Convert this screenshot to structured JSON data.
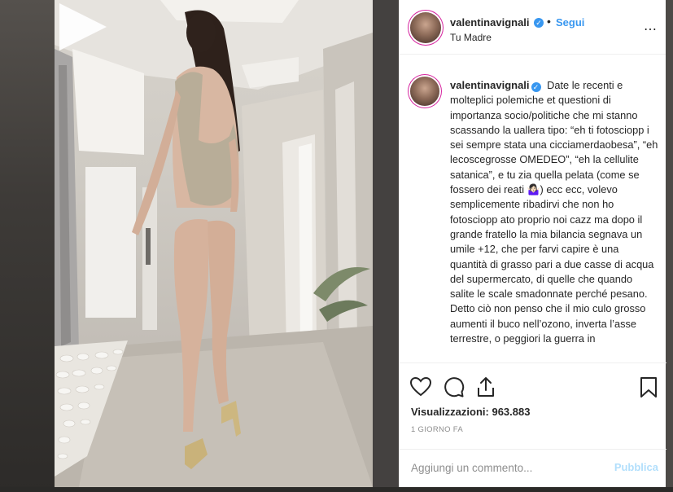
{
  "post": {
    "username": "valentinavignali",
    "verified_mark": "✓",
    "dot": "•",
    "follow_label": "Segui",
    "location": "Tu Madre",
    "more_icon": "⋯"
  },
  "caption": {
    "username": "valentinavignali",
    "text": "Date le recenti e molteplici polemiche et questioni di importanza socio/politiche che mi stanno scassando la uallera tipo: “eh ti fotosciopp i sei sempre stata una cicciamerdaobesa”, “eh lecoscegrosse OMEDEO”, “eh la cellulite satanica”, e tu zia quella pelata (come se fossero dei reati 🤷🏻‍♀️) ecc ecc, volevo semplicemente ribadirvi che non ho fotosciopp ato proprio noi cazz ma dopo il grande fratello la mia bilancia segnava un umile +12, che per farvi capire è una quantità di grasso pari a due casse di acqua del supermercato, di quelle che quando salite le scale smadonnate perché pesano. Detto ciò non penso che il mio culo grosso aumenti il buco nell’ozono, inverta l’asse terrestre, o peggiori la guerra in"
  },
  "actions": {
    "icons": [
      "heart-icon",
      "comment-icon",
      "share-icon",
      "bookmark-icon"
    ],
    "views_label": "Visualizzazioni:",
    "views_count": "963.883",
    "time_ago": "1 GIORNO FA"
  },
  "comment": {
    "placeholder": "Aggiungi un commento...",
    "post_label": "Pubblica"
  },
  "colors": {
    "accent": "#3897f0",
    "post_disabled": "#b2dffc",
    "text": "#262626",
    "muted": "#8e8e8e"
  }
}
